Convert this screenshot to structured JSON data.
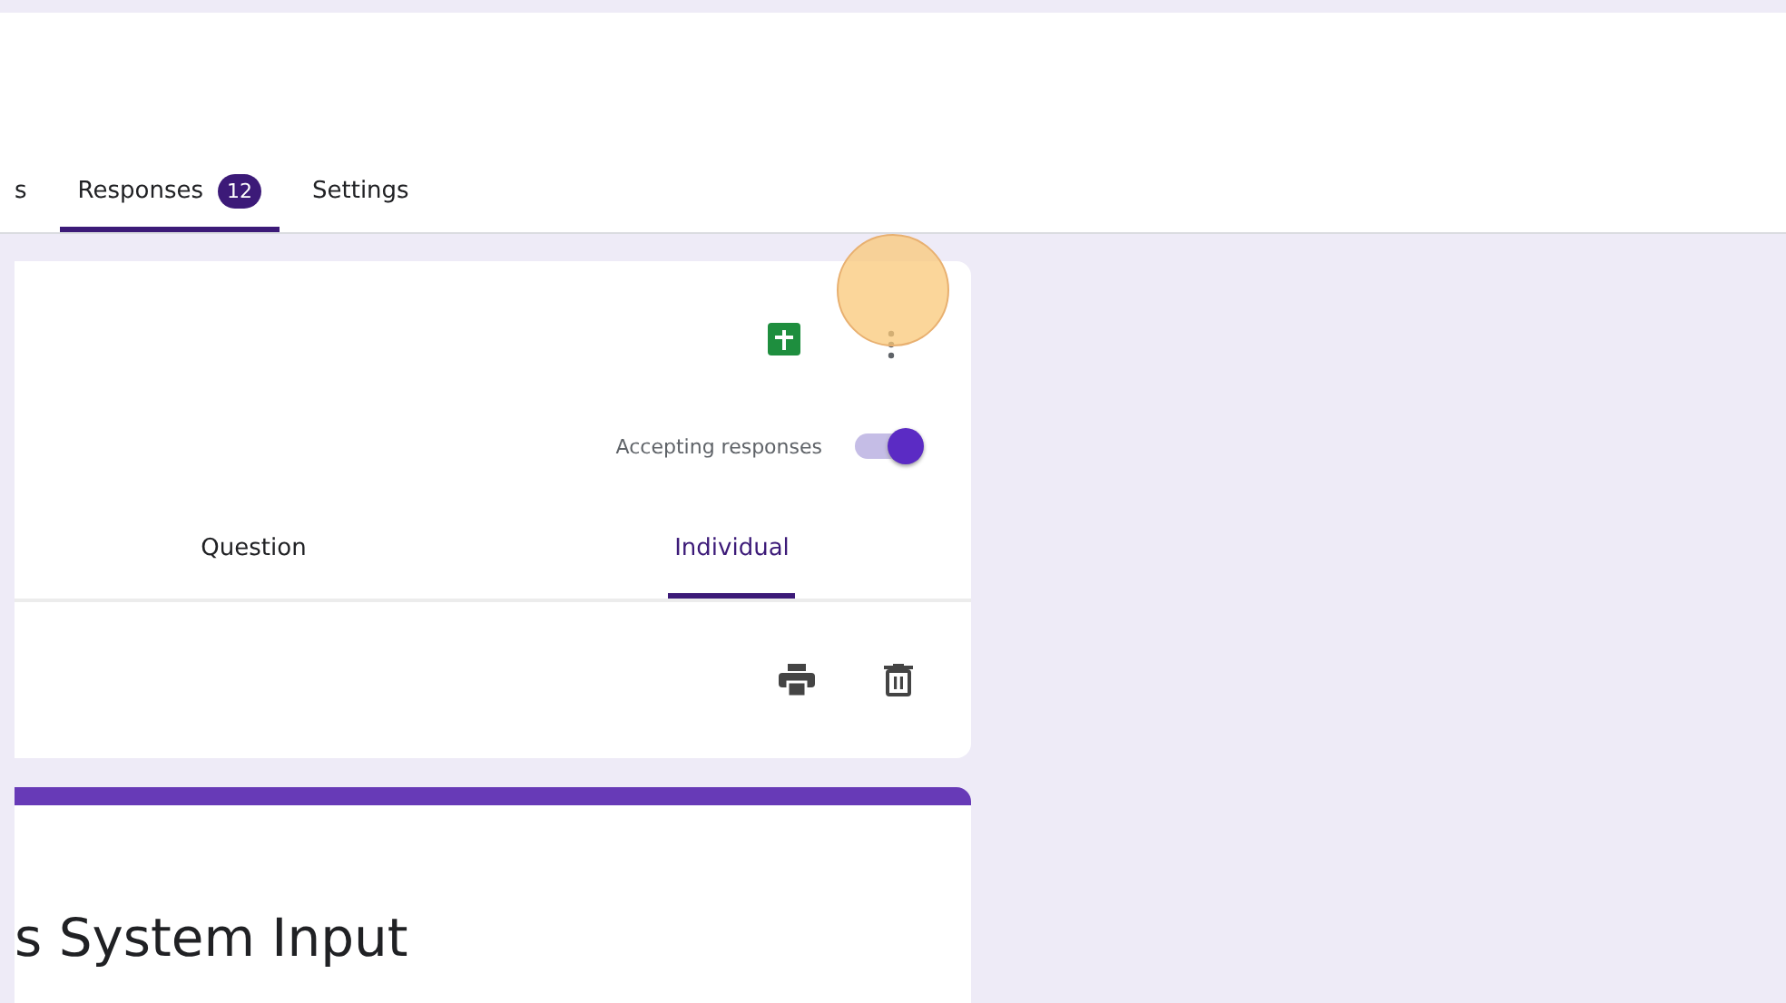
{
  "tabs": [
    {
      "label": "s",
      "selected": false
    },
    {
      "label": "Responses",
      "badge": "12",
      "selected": true
    },
    {
      "label": "Settings",
      "selected": false
    }
  ],
  "accepting": {
    "label": "Accepting responses",
    "on": true
  },
  "summary_tabs": [
    {
      "label": "Question",
      "selected": false
    },
    {
      "label": "Individual",
      "selected": true
    }
  ],
  "form": {
    "title": "s System Input"
  }
}
